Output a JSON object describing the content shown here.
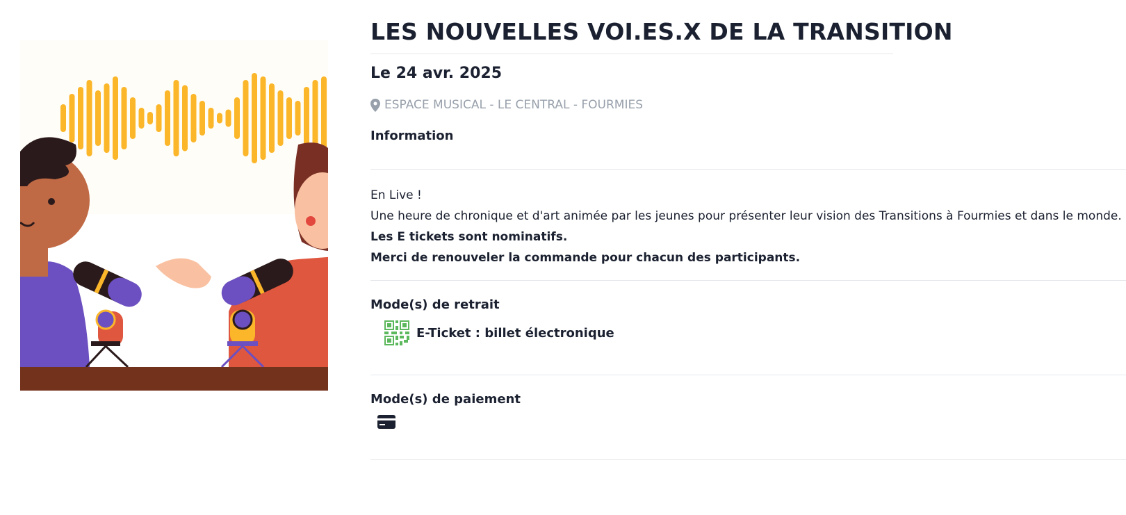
{
  "event": {
    "title": "LES NOUVELLES VOI.ES.X DE LA TRANSITION",
    "date": "Le 24 avr. 2025",
    "venue": "ESPACE MUSICAL - LE CENTRAL - FOURMIES"
  },
  "information": {
    "heading": "Information",
    "lines": [
      "En Live !",
      "Une heure de chronique et d'art animée par les jeunes pour présenter leur vision des Transitions à Fourmies et dans le monde."
    ],
    "bold_lines": [
      "Les E tickets sont nominatifs.",
      "Merci de renouveler la commande pour chacun des participants."
    ]
  },
  "withdrawal": {
    "heading": "Mode(s) de retrait",
    "option": "E-Ticket : billet électronique",
    "icon": "qr-code-icon",
    "icon_color": "#5cb85c"
  },
  "payment": {
    "heading": "Mode(s) de paiement",
    "icon": "credit-card-icon"
  },
  "colors": {
    "text": "#1b2130",
    "muted": "#98a0ab",
    "wave": "#fbb62a",
    "table": "#73321c"
  }
}
